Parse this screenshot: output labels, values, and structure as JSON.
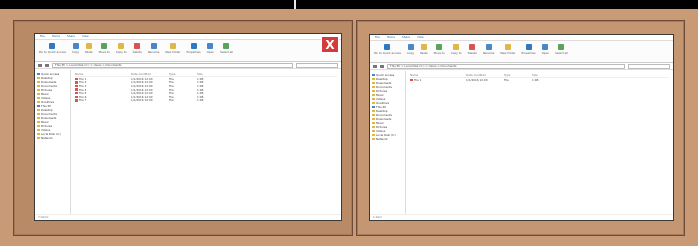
{
  "close_label": "X",
  "colors": {
    "desktop": "#c89b76",
    "frame_left": "#b98a66",
    "frame_right": "#c49672",
    "close": "#d63b3b"
  },
  "windows": [
    {
      "tabs": [
        "File",
        "Home",
        "Share",
        "View"
      ],
      "ribbon": [
        "Pin to Quick access",
        "Copy",
        "Paste",
        "Move to",
        "Copy to",
        "Delete",
        "Rename",
        "New folder",
        "Properties",
        "Open",
        "Select all"
      ],
      "address": "This PC > Local Disk (C:) > Users > Documents",
      "tree": [
        "Quick access",
        "Desktop",
        "Downloads",
        "Documents",
        "Pictures",
        "Music",
        "Videos",
        "OneDrive",
        "This PC",
        "Desktop",
        "Documents",
        "Downloads",
        "Music",
        "Pictures",
        "Videos",
        "Local Disk (C:)",
        "Network"
      ],
      "columns": [
        "Name",
        "Date modified",
        "Type",
        "Size"
      ],
      "files": [
        {
          "name": "File 1",
          "date": "1/1/2016 12:00",
          "type": "File",
          "size": "1 KB"
        },
        {
          "name": "File 2",
          "date": "1/1/2016 12:00",
          "type": "File",
          "size": "1 KB"
        },
        {
          "name": "File 3",
          "date": "1/1/2016 12:00",
          "type": "File",
          "size": "1 KB"
        },
        {
          "name": "File 4",
          "date": "1/1/2016 12:00",
          "type": "File",
          "size": "1 KB"
        },
        {
          "name": "File 5",
          "date": "1/1/2016 12:00",
          "type": "File",
          "size": "1 KB"
        },
        {
          "name": "File 6",
          "date": "1/1/2016 12:00",
          "type": "File",
          "size": "1 KB"
        },
        {
          "name": "File 7",
          "date": "1/1/2016 12:00",
          "type": "File",
          "size": "1 KB"
        }
      ],
      "status": "7 items"
    },
    {
      "tabs": [
        "File",
        "Home",
        "Share",
        "View"
      ],
      "ribbon": [
        "Pin to Quick access",
        "Copy",
        "Paste",
        "Move to",
        "Copy to",
        "Delete",
        "Rename",
        "New folder",
        "Properties",
        "Open",
        "Select all"
      ],
      "address": "This PC > Local Disk (C:) > Users > Documents",
      "tree": [
        "Quick access",
        "Desktop",
        "Downloads",
        "Documents",
        "Pictures",
        "Music",
        "Videos",
        "OneDrive",
        "This PC",
        "Desktop",
        "Documents",
        "Downloads",
        "Music",
        "Pictures",
        "Videos",
        "Local Disk (C:)",
        "Network"
      ],
      "columns": [
        "Name",
        "Date modified",
        "Type",
        "Size"
      ],
      "files": [
        {
          "name": "File 1",
          "date": "1/1/2016 12:00",
          "type": "File",
          "size": "1 KB"
        }
      ],
      "status": "1 item"
    }
  ]
}
